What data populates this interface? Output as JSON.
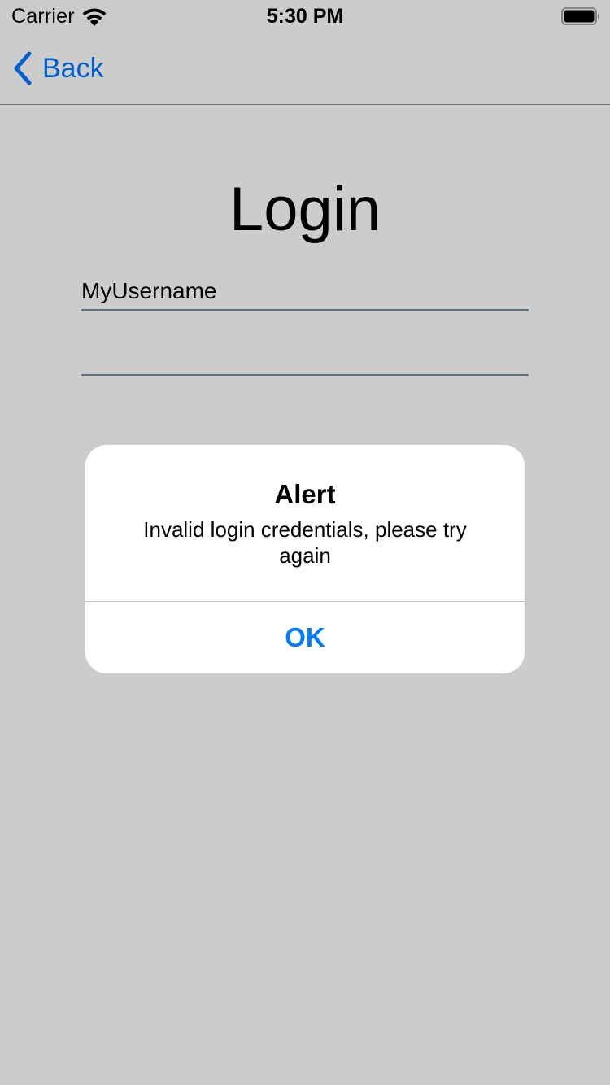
{
  "status_bar": {
    "carrier": "Carrier",
    "time": "5:30 PM",
    "wifi_icon": "wifi-icon",
    "battery_icon": "battery-icon"
  },
  "nav_bar": {
    "back_label": "Back",
    "back_icon": "chevron-left-icon"
  },
  "login": {
    "title": "Login",
    "username_value": "MyUsername",
    "password_value": ""
  },
  "alert": {
    "title": "Alert",
    "message": "Invalid login credentials, please try again",
    "ok_label": "OK"
  },
  "colors": {
    "accent": "#007aff",
    "field_underline": "#7a8fa6",
    "background": "#ffffff",
    "dim_overlay": "rgba(0,0,0,0.2)"
  }
}
